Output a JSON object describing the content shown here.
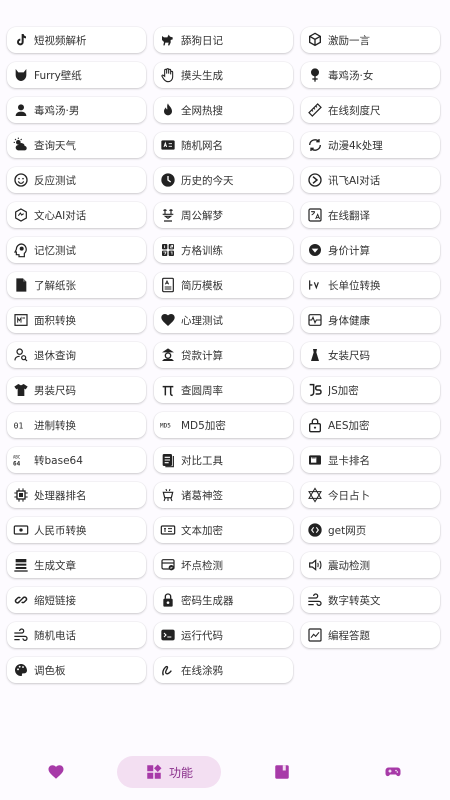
{
  "colors": {
    "accent": "#a73aa8",
    "active_bg": "#f3dff2",
    "icon": "#222222"
  },
  "tools": [
    {
      "label": "短视频解析",
      "icon": "tiktok-icon"
    },
    {
      "label": "舔狗日记",
      "icon": "dog-icon"
    },
    {
      "label": "激励一言",
      "icon": "cube-icon"
    },
    {
      "label": "Furry壁纸",
      "icon": "fox-icon"
    },
    {
      "label": "摸头生成",
      "icon": "hand-icon"
    },
    {
      "label": "毒鸡汤·女",
      "icon": "female-icon"
    },
    {
      "label": "毒鸡汤·男",
      "icon": "male-user-icon"
    },
    {
      "label": "全网热搜",
      "icon": "fire-icon"
    },
    {
      "label": "在线刻度尺",
      "icon": "ruler-icon"
    },
    {
      "label": "查询天气",
      "icon": "weather-icon"
    },
    {
      "label": "随机网名",
      "icon": "name-badge-icon"
    },
    {
      "label": "动漫4k处理",
      "icon": "image-sync-icon"
    },
    {
      "label": "反应测试",
      "icon": "smile-icon"
    },
    {
      "label": "历史的今天",
      "icon": "clock-icon"
    },
    {
      "label": "讯飞AI对话",
      "icon": "spark-icon"
    },
    {
      "label": "文心AI对话",
      "icon": "ai-chip-icon"
    },
    {
      "label": "周公解梦",
      "icon": "dream-glyph-icon"
    },
    {
      "label": "在线翻译",
      "icon": "translate-icon"
    },
    {
      "label": "记忆测试",
      "icon": "brain-head-icon"
    },
    {
      "label": "方格训练",
      "icon": "grid-numbers-icon"
    },
    {
      "label": "身价计算",
      "icon": "diamond-icon"
    },
    {
      "label": "了解纸张",
      "icon": "paper-icon"
    },
    {
      "label": "简历模板",
      "icon": "resume-icon"
    },
    {
      "label": "长单位转换",
      "icon": "length-unit-icon"
    },
    {
      "label": "面积转换",
      "icon": "area-icon"
    },
    {
      "label": "心理测试",
      "icon": "heart-icon"
    },
    {
      "label": "身体健康",
      "icon": "pulse-icon"
    },
    {
      "label": "退休查询",
      "icon": "person-search-icon"
    },
    {
      "label": "贷款计算",
      "icon": "loan-icon"
    },
    {
      "label": "女装尺码",
      "icon": "dress-icon"
    },
    {
      "label": "男装尺码",
      "icon": "shirt-icon"
    },
    {
      "label": "查圆周率",
      "icon": "pi-icon"
    },
    {
      "label": "JS加密",
      "icon": "js-icon"
    },
    {
      "label": "进制转换",
      "icon": "binary-icon"
    },
    {
      "label": "MD5加密",
      "icon": "md5-icon"
    },
    {
      "label": "AES加密",
      "icon": "lock-icon"
    },
    {
      "label": "转base64",
      "icon": "base64-icon"
    },
    {
      "label": "对比工具",
      "icon": "compare-icon"
    },
    {
      "label": "显卡排名",
      "icon": "gpu-icon"
    },
    {
      "label": "处理器排名",
      "icon": "cpu-icon"
    },
    {
      "label": "诸葛神签",
      "icon": "tripod-icon"
    },
    {
      "label": "今日占卜",
      "icon": "star-of-david-icon"
    },
    {
      "label": "人民币转换",
      "icon": "currency-icon"
    },
    {
      "label": "文本加密",
      "icon": "text-encrypt-icon"
    },
    {
      "label": "get网页",
      "icon": "web-code-icon"
    },
    {
      "label": "生成文章",
      "icon": "article-icon"
    },
    {
      "label": "坏点检测",
      "icon": "pixel-check-icon"
    },
    {
      "label": "震动检测",
      "icon": "vibration-icon"
    },
    {
      "label": "缩短链接",
      "icon": "link-icon"
    },
    {
      "label": "密码生成器",
      "icon": "password-icon"
    },
    {
      "label": "数字转英文",
      "icon": "wind-icon"
    },
    {
      "label": "随机电话",
      "icon": "wind-icon"
    },
    {
      "label": "运行代码",
      "icon": "terminal-icon"
    },
    {
      "label": "编程答题",
      "icon": "chart-line-icon"
    },
    {
      "label": "调色板",
      "icon": "palette-icon"
    },
    {
      "label": "在线涂鸦",
      "icon": "scribble-icon"
    }
  ],
  "nav": {
    "favorites_icon": "heart-icon",
    "features_label": "功能",
    "features_icon": "widgets-icon",
    "book_icon": "bookmark-icon",
    "game_icon": "gamepad-icon"
  }
}
